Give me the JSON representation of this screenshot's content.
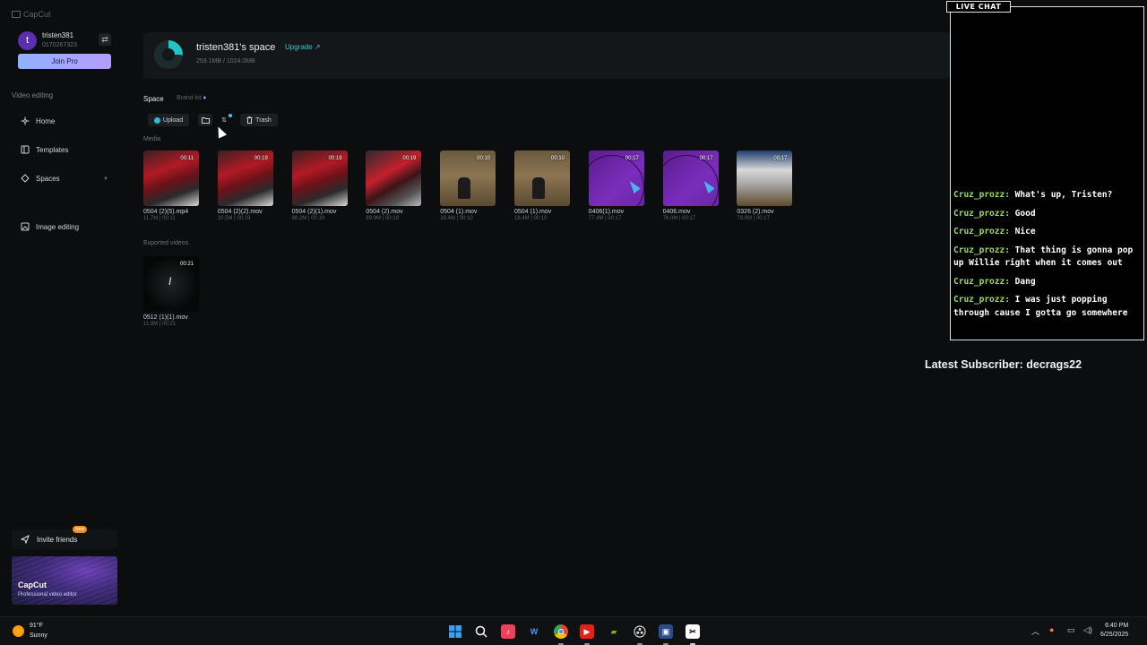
{
  "app": {
    "title": "CapCut"
  },
  "user": {
    "initial": "t",
    "name": "tristen381",
    "id": "0170267323",
    "join_label": "Join Pro"
  },
  "nav": {
    "section_label": "Video editing",
    "items": [
      {
        "label": "Home",
        "icon": "home-icon"
      },
      {
        "label": "Templates",
        "icon": "templates-icon"
      },
      {
        "label": "Spaces",
        "icon": "spaces-icon"
      },
      {
        "label": "Image editing",
        "icon": "image-editing-icon"
      }
    ]
  },
  "invite": {
    "label": "Invite friends",
    "badge": "New"
  },
  "promo": {
    "title": "CapCut",
    "subtitle": "Professional video editor"
  },
  "space": {
    "title": "tristen381's space",
    "upgrade": "Upgrade ↗",
    "usage": "259.1MB / 1024.0MB",
    "usage_fraction": 0.253,
    "accent": "#22c3c9"
  },
  "tabs": {
    "space": "Space",
    "brand_kit": "Brand kit"
  },
  "toolbar": {
    "upload": "Upload",
    "trash": "Trash"
  },
  "media_label": "Media",
  "media": [
    {
      "name": "0504 (2)(5).mp4",
      "meta": "11.7M | 00:11",
      "duration": "00:11",
      "style": "t-red"
    },
    {
      "name": "0504 (2)(2).mov",
      "meta": "20.5M | 00:19",
      "duration": "00:19",
      "style": "t-red"
    },
    {
      "name": "0504 (2)(1).mov",
      "meta": "88.2M | 00:19",
      "duration": "00:19",
      "style": "t-red"
    },
    {
      "name": "0504 (2).mov",
      "meta": "89.9M | 00:19",
      "duration": "00:19",
      "style": "t-red2"
    },
    {
      "name": "0504 (1).mov",
      "meta": "18.4M | 00:10",
      "duration": "00:10",
      "style": "t-court"
    },
    {
      "name": "0504 (1).mov",
      "meta": "18.4M | 00:10",
      "duration": "00:10",
      "style": "t-court"
    },
    {
      "name": "0406(1).mov",
      "meta": "77.4M | 00:17",
      "duration": "00:17",
      "style": "t-purple"
    },
    {
      "name": "0406.mov",
      "meta": "78.0M | 00:17",
      "duration": "00:17",
      "style": "t-purple"
    },
    {
      "name": "0326 (2).mov",
      "meta": "79.0M | 00:17",
      "duration": "00:17",
      "style": "t-game"
    }
  ],
  "exported_label": "Exported videos",
  "exported": [
    {
      "name": "0512 (1)(1).mov",
      "meta": "11.8M | 00:21",
      "duration": "00:21"
    }
  ],
  "chat": {
    "header": "LIVE CHAT",
    "messages": [
      {
        "user": "Cruz_prozz:",
        "text": "What's up, Tristen?"
      },
      {
        "user": "Cruz_prozz:",
        "text": "Good"
      },
      {
        "user": "Cruz_prozz:",
        "text": "Nice"
      },
      {
        "user": "Cruz_prozz:",
        "text": "That thing is gonna pop up Willie right when it comes out"
      },
      {
        "user": "Cruz_prozz:",
        "text": "Dang"
      },
      {
        "user": "Cruz_prozz:",
        "text": "I was just popping through cause I gotta go somewhere"
      }
    ],
    "latest_subscriber": "Latest Subscriber: decrags22"
  },
  "taskbar": {
    "weather_temp": "91°F",
    "weather_desc": "Sunny",
    "time": "6:40 PM",
    "date": "6/25/2025"
  }
}
